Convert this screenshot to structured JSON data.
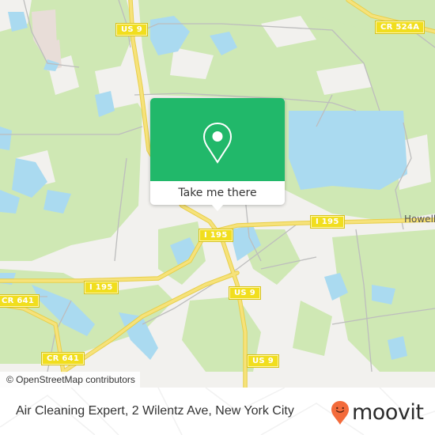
{
  "map": {
    "road_shields": [
      {
        "id": "us9-north",
        "label": "US 9"
      },
      {
        "id": "cr524a",
        "label": "CR 524A"
      },
      {
        "id": "i195-center",
        "label": "I 195"
      },
      {
        "id": "i195-east",
        "label": "I 195"
      },
      {
        "id": "i195-west",
        "label": "I 195"
      },
      {
        "id": "cr641-west",
        "label": "CR 641"
      },
      {
        "id": "us9-mid",
        "label": "US 9"
      },
      {
        "id": "cr641-south",
        "label": "CR 641"
      },
      {
        "id": "us9-south",
        "label": "US 9"
      }
    ],
    "place_labels": [
      {
        "id": "howell",
        "label": "Howell"
      }
    ],
    "attribution": "© OpenStreetMap contributors",
    "colors": {
      "land": "#f2f1ee",
      "forest": "#cfe8b4",
      "water": "#aadaf0",
      "highway": "#f5e06a",
      "minor_road": "#b9b9b9"
    }
  },
  "popup": {
    "icon": "map-pin-icon",
    "button_label": "Take me there",
    "accent_color": "#21b86a"
  },
  "footer": {
    "title": "Air Cleaning Expert, 2 Wilentz Ave, New York City",
    "brand": {
      "name": "moovit",
      "icon": "moovit-pin-icon",
      "color": "#f36b3b"
    }
  }
}
